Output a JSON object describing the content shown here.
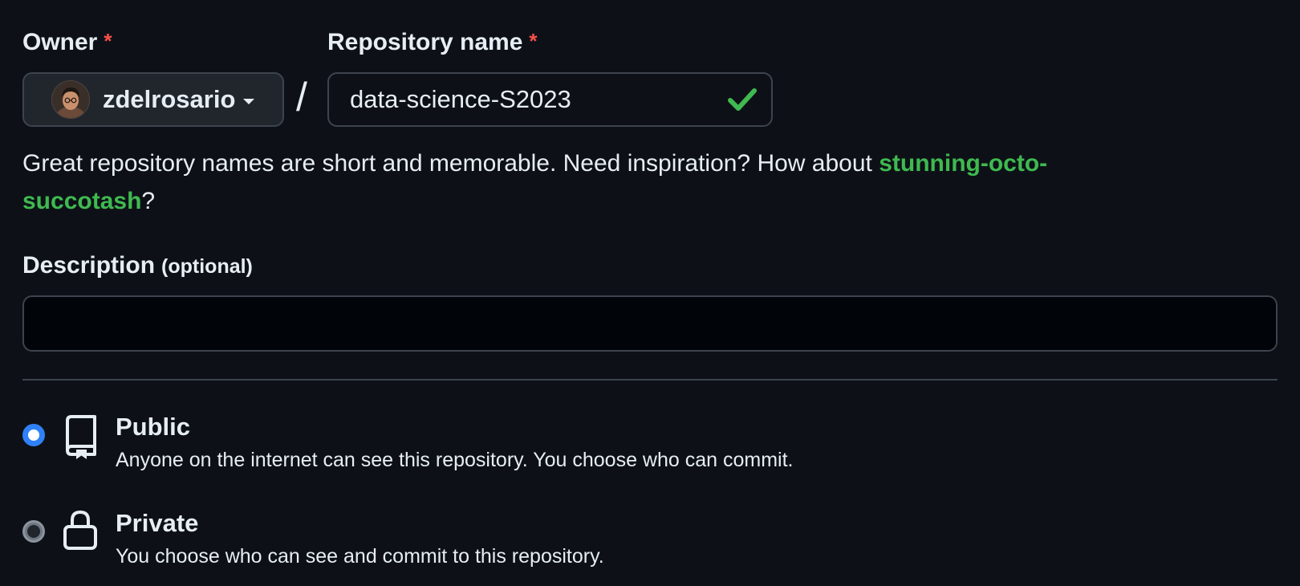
{
  "owner": {
    "label": "Owner",
    "required_marker": "*",
    "selected": "zdelrosario",
    "avatar_icon": "user-avatar"
  },
  "separator": "/",
  "repo_name": {
    "label": "Repository name",
    "required_marker": "*",
    "value": "data-science-S2023",
    "status_icon": "check-icon",
    "status_color": "#3fb950"
  },
  "hint": {
    "text": "Great repository names are short and memorable. Need inspiration? How about ",
    "suggestion": "stunning-octo-succotash",
    "suffix": "?"
  },
  "description": {
    "label": "Description",
    "optional_text": "(optional)",
    "value": "",
    "placeholder": ""
  },
  "visibility": {
    "options": [
      {
        "title": "Public",
        "description": "Anyone on the internet can see this repository. You choose who can commit.",
        "icon": "repo-icon",
        "checked": true
      },
      {
        "title": "Private",
        "description": "You choose who can see and commit to this repository.",
        "icon": "lock-icon",
        "checked": false
      }
    ]
  },
  "colors": {
    "background": "#0d1117",
    "accent_blue": "#2f81f7",
    "success_green": "#3fb950",
    "required_red": "#f85149",
    "border": "#3d444d"
  }
}
